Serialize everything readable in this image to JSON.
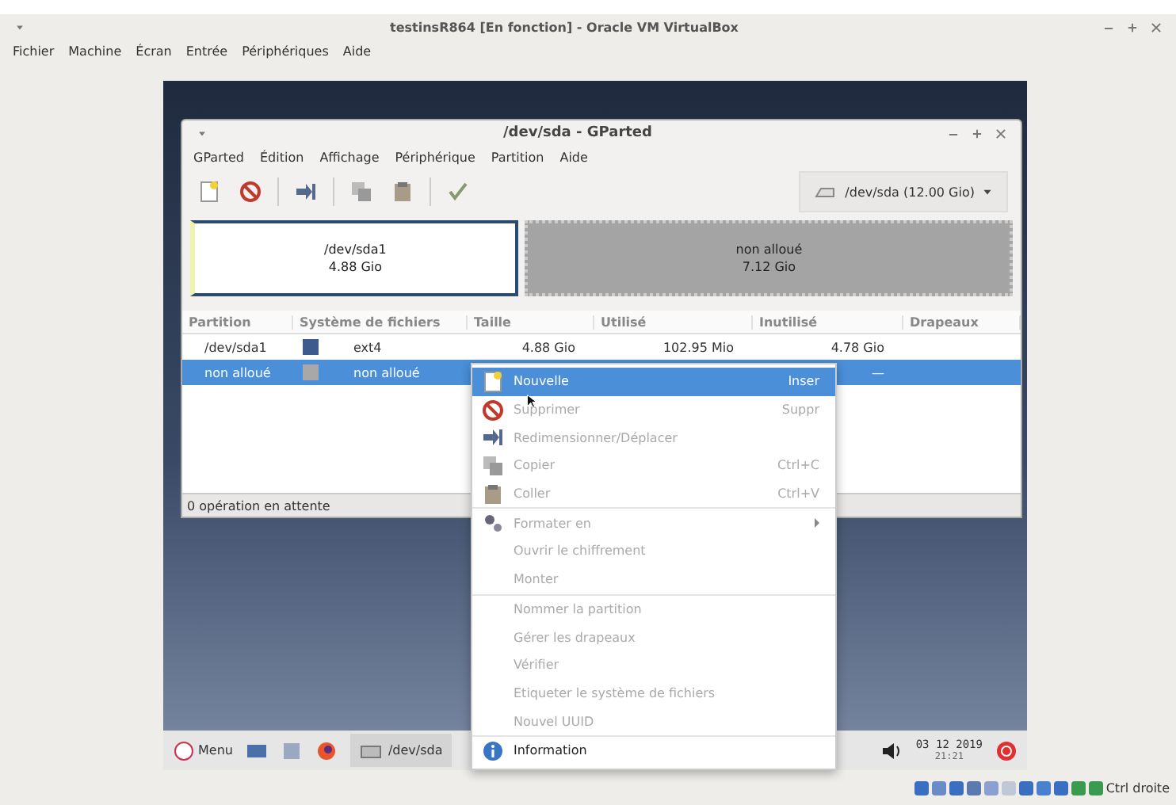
{
  "vbox": {
    "title": "testinsR864 [En fonction] - Oracle VM VirtualBox",
    "menu": [
      "Fichier",
      "Machine",
      "Écran",
      "Entrée",
      "Périphériques",
      "Aide"
    ],
    "host_key": "Ctrl droite"
  },
  "gparted": {
    "title": "/dev/sda - GParted",
    "menu": [
      "GParted",
      "Édition",
      "Affichage",
      "Périphérique",
      "Partition",
      "Aide"
    ],
    "device": "/dev/sda  (12.00 Gio)",
    "disk_map": [
      {
        "name": "/dev/sda1",
        "size": "4.88 Gio",
        "kind": "partition",
        "selected": true
      },
      {
        "name": "non alloué",
        "size": "7.12 Gio",
        "kind": "unallocated",
        "selected": false
      }
    ],
    "columns": [
      "Partition",
      "Système de fichiers",
      "Taille",
      "Utilisé",
      "Inutilisé",
      "Drapeaux"
    ],
    "rows": [
      {
        "partition": "/dev/sda1",
        "color": "#3d5b8c",
        "filesystem": "ext4",
        "size": "4.88 Gio",
        "used": "102.95 Mio",
        "unused": "4.78 Gio",
        "selected": false
      },
      {
        "partition": "non alloué",
        "color": "#a8a8a8",
        "filesystem": "non alloué",
        "unused": "—",
        "selected": true
      }
    ],
    "status": "0 opération en attente"
  },
  "context_menu": {
    "groups": [
      [
        {
          "label": "Nouvelle",
          "shortcut": "Inser",
          "kind": "new",
          "disabled": false,
          "selected": true,
          "submenu": false
        },
        {
          "label": "Supprimer",
          "shortcut": "Suppr",
          "kind": "delete",
          "disabled": true,
          "selected": false,
          "submenu": false
        },
        {
          "label": "Redimensionner/Déplacer",
          "kind": "resize",
          "disabled": true,
          "selected": false,
          "submenu": false
        },
        {
          "label": "Copier",
          "shortcut": "Ctrl+C",
          "kind": "copy",
          "disabled": true,
          "selected": false,
          "submenu": false
        },
        {
          "label": "Coller",
          "shortcut": "Ctrl+V",
          "kind": "paste",
          "disabled": true,
          "selected": false,
          "submenu": false
        }
      ],
      [
        {
          "label": "Formater en",
          "kind": "format",
          "disabled": true,
          "selected": false,
          "submenu": true
        },
        {
          "label": "Ouvrir le chiffrement",
          "kind": "plain",
          "disabled": true,
          "selected": false,
          "submenu": false
        },
        {
          "label": "Monter",
          "kind": "plain",
          "disabled": true,
          "selected": false,
          "submenu": false
        }
      ],
      [
        {
          "label": "Nommer la partition",
          "kind": "plain",
          "disabled": true,
          "selected": false,
          "submenu": false
        },
        {
          "label": "Gérer les drapeaux",
          "kind": "plain",
          "disabled": true,
          "selected": false,
          "submenu": false
        },
        {
          "label": "Vérifier",
          "kind": "plain",
          "disabled": true,
          "selected": false,
          "submenu": false
        },
        {
          "label": "Etiqueter le système de fichiers",
          "kind": "plain",
          "disabled": true,
          "selected": false,
          "submenu": false
        },
        {
          "label": "Nouvel UUID",
          "kind": "plain",
          "disabled": true,
          "selected": false,
          "submenu": false
        }
      ],
      [
        {
          "label": "Information",
          "kind": "info",
          "disabled": false,
          "selected": false,
          "submenu": false
        }
      ]
    ]
  },
  "taskbar": {
    "menu_label": "Menu",
    "task": "/dev/sda",
    "date": "03 12 2019",
    "time": "21:21"
  }
}
